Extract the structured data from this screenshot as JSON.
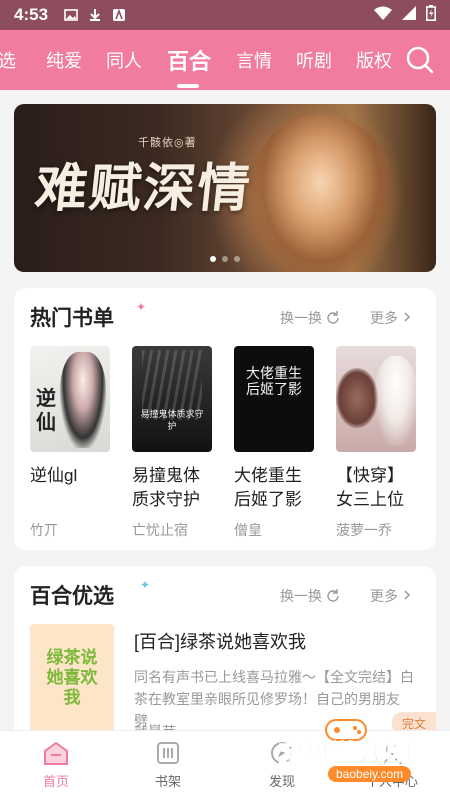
{
  "status": {
    "time": "4:53"
  },
  "tabs": [
    {
      "label": "选"
    },
    {
      "label": "纯爱"
    },
    {
      "label": "同人"
    },
    {
      "label": "百合"
    },
    {
      "label": "言情"
    },
    {
      "label": "听剧"
    },
    {
      "label": "版权"
    }
  ],
  "active_tab": "百合",
  "banner": {
    "title": "难赋深情",
    "author": "千骸依◎著"
  },
  "hot_list": {
    "title": "热门书单",
    "refresh_label": "换一换",
    "more_label": "更多",
    "books": [
      {
        "title": "逆仙gl",
        "author": "竹丌",
        "cover_text": "逆仙"
      },
      {
        "title": "易撞鬼体质求守护",
        "author": "亡忧止宿",
        "cover_text": "易撞鬼体质求守护"
      },
      {
        "title": "大佬重生后姬了影",
        "author": "僧皇",
        "cover_text": "大佬重生后姬了影"
      },
      {
        "title": "【快穿】女三上位",
        "author": "菠萝一乔",
        "cover_text": ""
      }
    ]
  },
  "featured": {
    "title": "百合优选",
    "refresh_label": "换一换",
    "more_label": "更多",
    "book": {
      "title": "[百合]绿茶说她喜欢我",
      "desc": "同名有声书已上线喜马拉雅～【全文完结】白茶在教室里亲眼所见修罗场！自己的男朋友劈…",
      "author": "就是苹",
      "tag": "完文",
      "cover_text": "绿茶说她喜欢我"
    }
  },
  "bottom_nav": [
    {
      "label": "首页"
    },
    {
      "label": "书架"
    },
    {
      "label": "发现"
    },
    {
      "label": "个人中心"
    }
  ],
  "watermark": {
    "text": "宝贝游戏网",
    "url": "baobeiy.com"
  },
  "colors": {
    "accent": "#f17ca0",
    "statusbar": "#8e4d5f"
  }
}
